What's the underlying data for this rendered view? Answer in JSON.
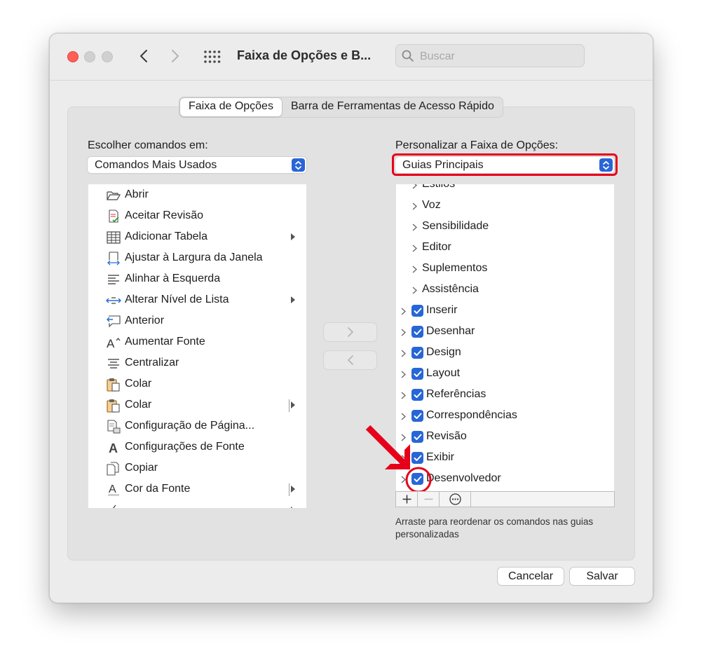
{
  "window": {
    "title": "Faixa de Opções e B...",
    "search_placeholder": "Buscar"
  },
  "tabs": [
    "Faixa de Opções",
    "Barra de Ferramentas de Acesso Rápido"
  ],
  "left": {
    "label": "Escolher comandos em:",
    "select_value": "Comandos Mais Usados",
    "items": [
      {
        "label": "Abrir",
        "icon": "folder-open-icon"
      },
      {
        "label": "Aceitar Revisão",
        "icon": "accept-revision-icon"
      },
      {
        "label": "Adicionar Tabela",
        "icon": "table-icon"
      },
      {
        "label": "Ajustar à Largura da Janela",
        "icon": "fit-width-icon"
      },
      {
        "label": "Alinhar à Esquerda",
        "icon": "align-left-icon"
      },
      {
        "label": "Alterar Nível de Lista",
        "icon": "list-level-icon"
      },
      {
        "label": "Anterior",
        "icon": "previous-comment-icon"
      },
      {
        "label": "Aumentar Fonte",
        "icon": "increase-font-icon"
      },
      {
        "label": "Centralizar",
        "icon": "align-center-icon"
      },
      {
        "label": "Colar",
        "icon": "paste-icon"
      },
      {
        "label": "Colar",
        "icon": "paste-icon"
      },
      {
        "label": "Configuração de Página...",
        "icon": "page-setup-icon"
      },
      {
        "label": "Configurações de Fonte",
        "icon": "font-settings-icon"
      },
      {
        "label": "Copiar",
        "icon": "copy-icon"
      },
      {
        "label": "Cor da Fonte",
        "icon": "font-color-icon"
      }
    ]
  },
  "right": {
    "label": "Personalizar a Faixa de Opções:",
    "select_value": "Guias Principais",
    "sub_items": [
      "Estilos",
      "Voz",
      "Sensibilidade",
      "Editor",
      "Suplementos",
      "Assistência"
    ],
    "tabs": [
      {
        "label": "Inserir",
        "checked": true
      },
      {
        "label": "Desenhar",
        "checked": true
      },
      {
        "label": "Design",
        "checked": true
      },
      {
        "label": "Layout",
        "checked": true
      },
      {
        "label": "Referências",
        "checked": true
      },
      {
        "label": "Correspondências",
        "checked": true
      },
      {
        "label": "Revisão",
        "checked": true
      },
      {
        "label": "Exibir",
        "checked": true
      },
      {
        "label": "Desenvolvedor",
        "checked": true
      }
    ],
    "hint": "Arraste para reordenar os comandos nas guias personalizadas"
  },
  "buttons": {
    "cancel": "Cancelar",
    "save": "Salvar"
  },
  "colors": {
    "accent": "#2766d6",
    "highlight": "#e6001a",
    "close": "#fe5f57"
  }
}
